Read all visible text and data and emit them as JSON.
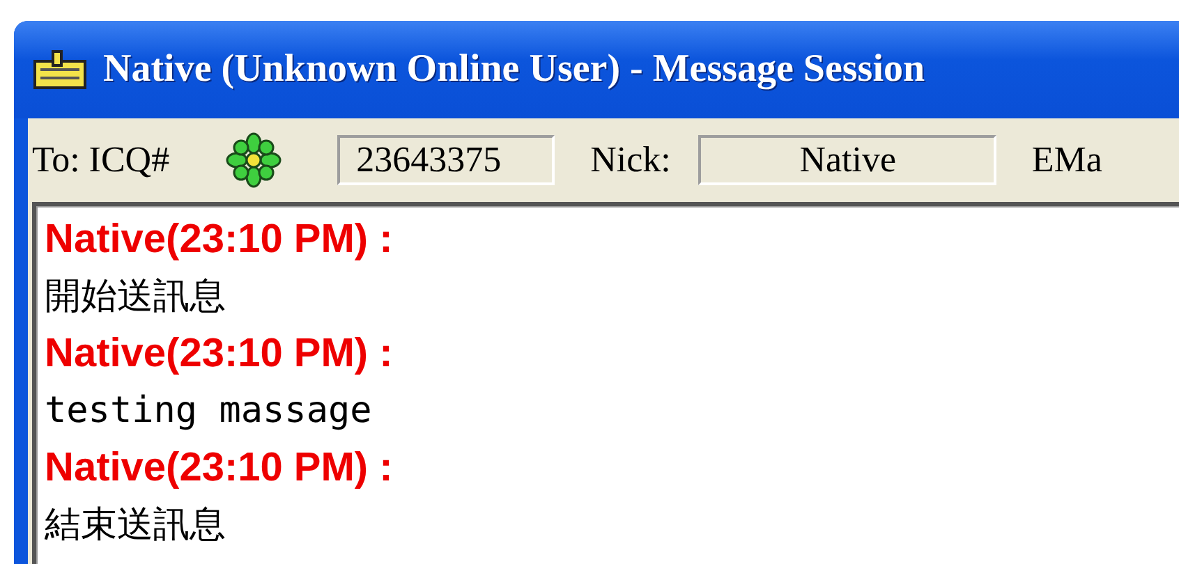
{
  "window": {
    "title": "Native (Unknown Online User) - Message Session"
  },
  "header": {
    "to_label": "To: ICQ#",
    "uin": "23643375",
    "nick_label": "Nick:",
    "nick": "Native",
    "email_label": "EMa"
  },
  "messages": [
    {
      "sender": "Native(23:10 PM) :",
      "text": "開始送訊息"
    },
    {
      "sender": "Native(23:10 PM) :",
      "text": "testing massage"
    },
    {
      "sender": "Native(23:10 PM) :",
      "text": "結束送訊息"
    }
  ]
}
